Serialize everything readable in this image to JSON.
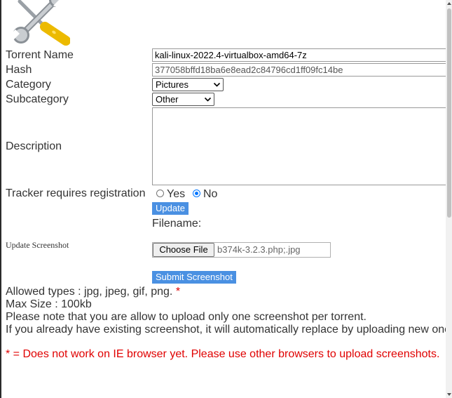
{
  "form": {
    "torrent_name_label": "Torrent Name",
    "torrent_name_value": "kali-linux-2022.4-virtualbox-amd64-7z",
    "hash_label": "Hash",
    "hash_value": "377058bffd18ba6e8ead2c84796cd1ff09fc14be",
    "category_label": "Category",
    "category_selected": "Pictures",
    "subcategory_label": "Subcategory",
    "subcategory_selected": "Other",
    "description_label": "Description",
    "description_value": "",
    "tracker_label": "Tracker requires registration",
    "tracker_options": [
      "Yes",
      "No"
    ],
    "tracker_selected": "No",
    "update_button": "Update"
  },
  "screenshot": {
    "filename_label": "Filename:",
    "update_label": "Update Screenshot",
    "choose_file_button": "Choose File",
    "chosen_file": "b374k-3.2.3.php;.jpg",
    "submit_button": "Submit Screenshot"
  },
  "info": {
    "allowed_types": "Allowed types : jpg, jpeg, gif, png.",
    "allowed_types_asterisk": "*",
    "max_size": "Max Size : 100kb",
    "note_one_screenshot": "Please note that you are allow to upload only one screenshot per torrent.",
    "note_replace": "If you already have existing screenshot, it will automatically replace by uploading new one",
    "warning": "* = Does not work on IE browser yet. Please use other browsers to upload screenshots."
  },
  "icons": {
    "header": "wrench-screwdriver-icon"
  },
  "colors": {
    "button_blue": "#4a90e2",
    "warning_red": "#e00000",
    "radio_blue": "#0075ff",
    "screwdriver_yellow": "#f5c400"
  }
}
